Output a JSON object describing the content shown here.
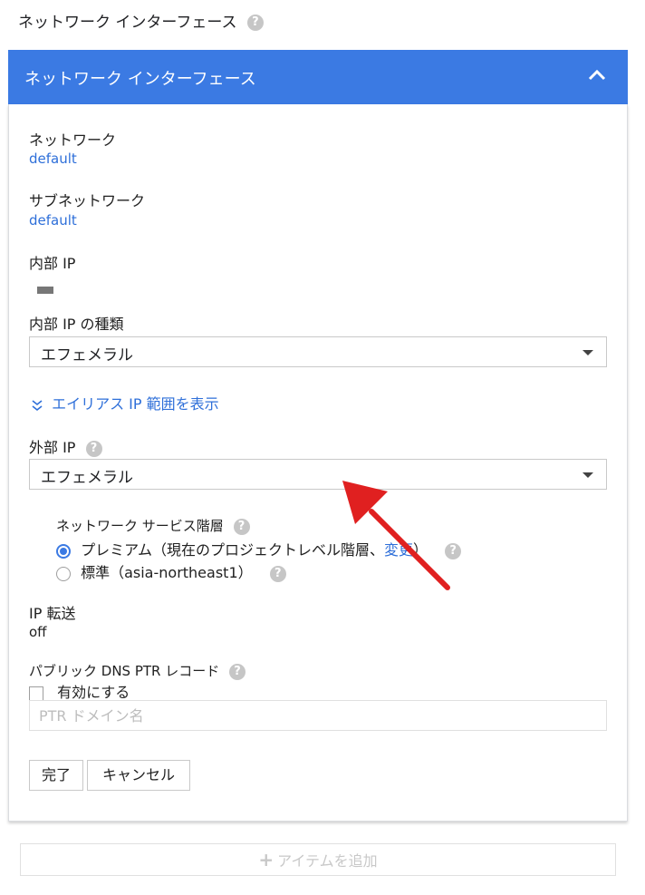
{
  "section": {
    "title": "ネットワーク インターフェース",
    "help": "?"
  },
  "panel": {
    "header_title": "ネットワーク インターフェース"
  },
  "network": {
    "label": "ネットワーク",
    "value": "default"
  },
  "subnetwork": {
    "label": "サブネットワーク",
    "value": "default"
  },
  "internal_ip": {
    "label": "内部 IP"
  },
  "internal_ip_type": {
    "label": "内部 IP の種類",
    "selected": "エフェメラル"
  },
  "alias_ip": {
    "link": "エイリアス IP 範囲を表示"
  },
  "external_ip": {
    "label": "外部 IP",
    "selected": "エフェメラル"
  },
  "network_tier": {
    "label": "ネットワーク サービス階層",
    "options": [
      {
        "text": "プレミアム（現在のプロジェクトレベル階層、",
        "link": "変更",
        "suffix": "）",
        "checked": true
      },
      {
        "text": "標準（asia-northeast1）",
        "checked": false
      }
    ]
  },
  "ip_forwarding": {
    "label": "IP 転送",
    "value": "off"
  },
  "dns_ptr": {
    "label": "パブリック DNS PTR レコード",
    "checkbox_label": "有効にする",
    "placeholder": "PTR ドメイン名"
  },
  "buttons": {
    "done": "完了",
    "cancel": "キャンセル"
  },
  "add_item": {
    "label": "アイテムを追加",
    "icon": "+"
  },
  "colors": {
    "accent": "#3b7ae3",
    "link": "#2e6fd9",
    "arrow": "#e02020"
  }
}
